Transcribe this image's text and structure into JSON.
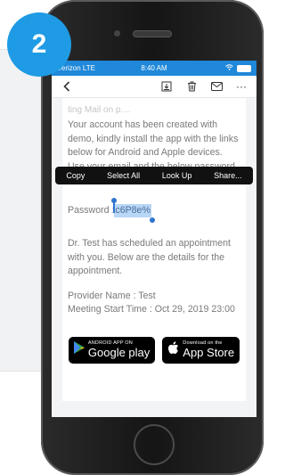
{
  "step_badge": "2",
  "status_bar": {
    "carrier": "Verizon LTE",
    "time": "8:40 AM"
  },
  "toolbar": {
    "more": "···"
  },
  "email": {
    "faded_text": "ting Mail on p....",
    "intro": "Your account has been created with demo, kindly install the app with the links below for Android and Apple devices. Use your email and the below password to use",
    "password_label": "Password : ",
    "password_value": "c6P8e%",
    "appointment_text": "Dr. Test has scheduled an appointment with you. Below are the details for the appointment.",
    "provider": "Provider Name : Test",
    "meeting": "Meeting Start Time : Oct 29, 2019 23:00"
  },
  "context_menu": [
    "Copy",
    "Select All",
    "Look Up",
    "Share..."
  ],
  "badges": {
    "google_small": "ANDROID APP ON",
    "google_big": "Google play",
    "apple_small": "Download on the",
    "apple_big": "App Store"
  },
  "colors": {
    "badge": "#1e9be4",
    "status_bar": "#1f88d9",
    "selection": "#b9d7f6"
  }
}
